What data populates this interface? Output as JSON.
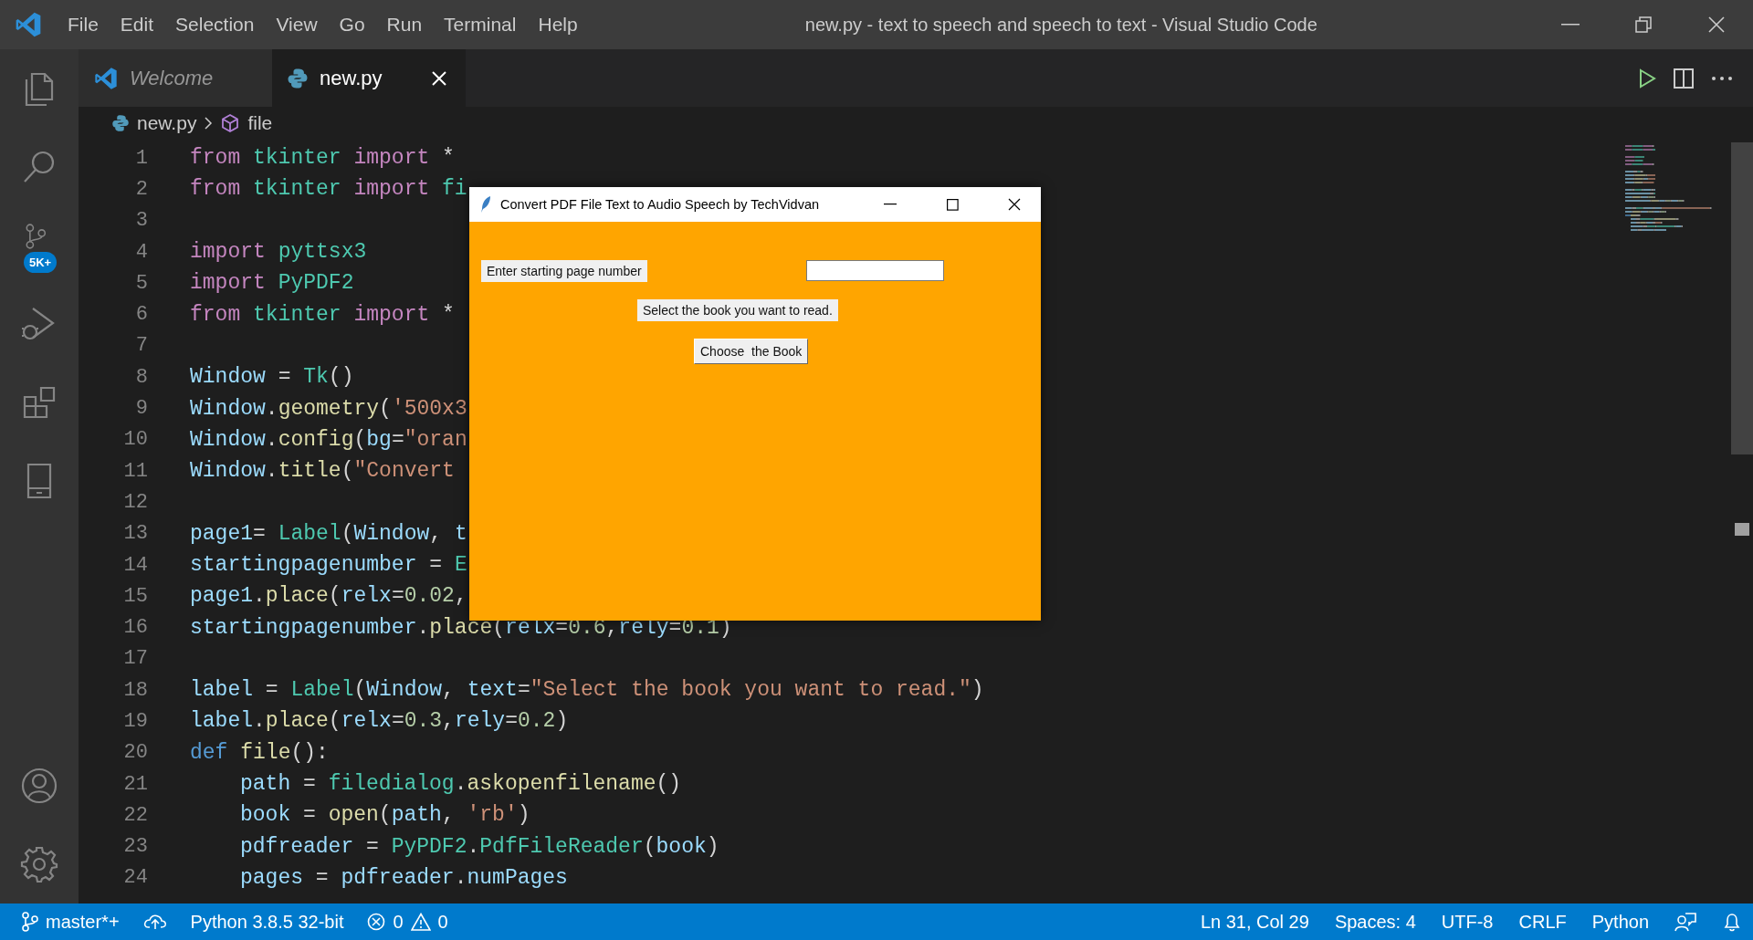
{
  "window": {
    "title": "new.py - text to speech and speech to text - Visual Studio Code"
  },
  "menu": [
    "File",
    "Edit",
    "Selection",
    "View",
    "Go",
    "Run",
    "Terminal",
    "Help"
  ],
  "activity_bar": {
    "source_control_badge": "5K+"
  },
  "tabs": [
    {
      "label": "Welcome",
      "kind": "welcome",
      "selected": false
    },
    {
      "label": "new.py",
      "kind": "python",
      "selected": true
    }
  ],
  "breadcrumb": [
    {
      "label": "new.py",
      "kind": "python"
    },
    {
      "label": "file",
      "kind": "symbol"
    }
  ],
  "code_lines": [
    {
      "number": "1",
      "tokens": [
        {
          "kind": "keyword",
          "text": "from "
        },
        {
          "kind": "module",
          "text": "tkinter "
        },
        {
          "kind": "keyword",
          "text": "import "
        },
        {
          "kind": "plain",
          "text": "*"
        }
      ]
    },
    {
      "number": "2",
      "tokens": [
        {
          "kind": "keyword",
          "text": "from "
        },
        {
          "kind": "module",
          "text": "tkinter "
        },
        {
          "kind": "keyword",
          "text": "import "
        },
        {
          "kind": "module",
          "text": "fi"
        }
      ]
    },
    {
      "number": "3"
    },
    {
      "number": "4",
      "tokens": [
        {
          "kind": "keyword",
          "text": "import "
        },
        {
          "kind": "module",
          "text": "pyttsx3"
        }
      ]
    },
    {
      "number": "5",
      "tokens": [
        {
          "kind": "keyword",
          "text": "import "
        },
        {
          "kind": "module",
          "text": "PyPDF2"
        }
      ]
    },
    {
      "number": "6",
      "tokens": [
        {
          "kind": "keyword",
          "text": "from "
        },
        {
          "kind": "module",
          "text": "tkinter "
        },
        {
          "kind": "keyword",
          "text": "import "
        },
        {
          "kind": "plain",
          "text": "*"
        }
      ]
    },
    {
      "number": "7"
    },
    {
      "number": "8",
      "tokens": [
        {
          "kind": "variable",
          "text": "Window"
        },
        {
          "kind": "plain",
          "text": " = "
        },
        {
          "kind": "module",
          "text": "Tk"
        },
        {
          "kind": "plain",
          "text": "()"
        }
      ]
    },
    {
      "number": "9",
      "tokens": [
        {
          "kind": "variable",
          "text": "Window"
        },
        {
          "kind": "plain",
          "text": "."
        },
        {
          "kind": "function",
          "text": "geometry"
        },
        {
          "kind": "plain",
          "text": "("
        },
        {
          "kind": "string",
          "text": "'500x3"
        }
      ]
    },
    {
      "number": "10",
      "tokens": [
        {
          "kind": "variable",
          "text": "Window"
        },
        {
          "kind": "plain",
          "text": "."
        },
        {
          "kind": "function",
          "text": "config"
        },
        {
          "kind": "plain",
          "text": "("
        },
        {
          "kind": "variable",
          "text": "bg"
        },
        {
          "kind": "plain",
          "text": "="
        },
        {
          "kind": "string",
          "text": "\"oran"
        }
      ]
    },
    {
      "number": "11",
      "tokens": [
        {
          "kind": "variable",
          "text": "Window"
        },
        {
          "kind": "plain",
          "text": "."
        },
        {
          "kind": "function",
          "text": "title"
        },
        {
          "kind": "plain",
          "text": "("
        },
        {
          "kind": "string",
          "text": "\"Convert"
        }
      ]
    },
    {
      "number": "12"
    },
    {
      "number": "13",
      "tokens": [
        {
          "kind": "variable",
          "text": "page1"
        },
        {
          "kind": "plain",
          "text": "= "
        },
        {
          "kind": "module",
          "text": "Label"
        },
        {
          "kind": "plain",
          "text": "("
        },
        {
          "kind": "variable",
          "text": "Window"
        },
        {
          "kind": "plain",
          "text": ", "
        },
        {
          "kind": "variable",
          "text": "t"
        }
      ]
    },
    {
      "number": "14",
      "tokens": [
        {
          "kind": "variable",
          "text": "startingpagenumber"
        },
        {
          "kind": "plain",
          "text": " = "
        },
        {
          "kind": "module",
          "text": "E"
        }
      ]
    },
    {
      "number": "15",
      "tokens": [
        {
          "kind": "variable",
          "text": "page1"
        },
        {
          "kind": "plain",
          "text": "."
        },
        {
          "kind": "function",
          "text": "place"
        },
        {
          "kind": "plain",
          "text": "("
        },
        {
          "kind": "variable",
          "text": "relx"
        },
        {
          "kind": "plain",
          "text": "="
        },
        {
          "kind": "number",
          "text": "0.02"
        },
        {
          "kind": "plain",
          "text": ","
        }
      ]
    },
    {
      "number": "16",
      "tokens": [
        {
          "kind": "variable",
          "text": "startingpagenumber"
        },
        {
          "kind": "plain",
          "text": "."
        },
        {
          "kind": "function",
          "text": "place"
        },
        {
          "kind": "plain",
          "text": "("
        },
        {
          "kind": "variable",
          "text": "relx"
        },
        {
          "kind": "plain",
          "text": "="
        },
        {
          "kind": "number",
          "text": "0.6"
        },
        {
          "kind": "plain",
          "text": ","
        },
        {
          "kind": "variable",
          "text": "rely"
        },
        {
          "kind": "plain",
          "text": "="
        },
        {
          "kind": "number",
          "text": "0.1"
        },
        {
          "kind": "plain",
          "text": ")"
        }
      ]
    },
    {
      "number": "17"
    },
    {
      "number": "18",
      "tokens": [
        {
          "kind": "variable",
          "text": "label"
        },
        {
          "kind": "plain",
          "text": " = "
        },
        {
          "kind": "module",
          "text": "Label"
        },
        {
          "kind": "plain",
          "text": "("
        },
        {
          "kind": "variable",
          "text": "Window"
        },
        {
          "kind": "plain",
          "text": ", "
        },
        {
          "kind": "variable",
          "text": "text"
        },
        {
          "kind": "plain",
          "text": "="
        },
        {
          "kind": "string",
          "text": "\"Select the book you want to read.\""
        },
        {
          "kind": "plain",
          "text": ")"
        }
      ]
    },
    {
      "number": "19",
      "tokens": [
        {
          "kind": "variable",
          "text": "label"
        },
        {
          "kind": "plain",
          "text": "."
        },
        {
          "kind": "function",
          "text": "place"
        },
        {
          "kind": "plain",
          "text": "("
        },
        {
          "kind": "variable",
          "text": "relx"
        },
        {
          "kind": "plain",
          "text": "="
        },
        {
          "kind": "number",
          "text": "0.3"
        },
        {
          "kind": "plain",
          "text": ","
        },
        {
          "kind": "variable",
          "text": "rely"
        },
        {
          "kind": "plain",
          "text": "="
        },
        {
          "kind": "number",
          "text": "0.2"
        },
        {
          "kind": "plain",
          "text": ")"
        }
      ]
    },
    {
      "number": "20",
      "tokens": [
        {
          "kind": "storage",
          "text": "def "
        },
        {
          "kind": "function",
          "text": "file"
        },
        {
          "kind": "plain",
          "text": "():"
        }
      ],
      "children": [
        {
          "number": "21",
          "tokens": [
            {
              "kind": "variable",
              "text": "path"
            },
            {
              "kind": "plain",
              "text": " = "
            },
            {
              "kind": "module",
              "text": "filedialog"
            },
            {
              "kind": "plain",
              "text": "."
            },
            {
              "kind": "function",
              "text": "askopenfilename"
            },
            {
              "kind": "plain",
              "text": "()"
            }
          ]
        },
        {
          "number": "22",
          "tokens": [
            {
              "kind": "variable",
              "text": "book"
            },
            {
              "kind": "plain",
              "text": " = "
            },
            {
              "kind": "function",
              "text": "open"
            },
            {
              "kind": "plain",
              "text": "("
            },
            {
              "kind": "variable",
              "text": "path"
            },
            {
              "kind": "plain",
              "text": ", "
            },
            {
              "kind": "string",
              "text": "'rb'"
            },
            {
              "kind": "plain",
              "text": ")"
            }
          ]
        },
        {
          "number": "23",
          "tokens": [
            {
              "kind": "variable",
              "text": "pdfreader"
            },
            {
              "kind": "plain",
              "text": " = "
            },
            {
              "kind": "module",
              "text": "PyPDF2"
            },
            {
              "kind": "plain",
              "text": "."
            },
            {
              "kind": "module",
              "text": "PdfFileReader"
            },
            {
              "kind": "plain",
              "text": "("
            },
            {
              "kind": "variable",
              "text": "book"
            },
            {
              "kind": "plain",
              "text": ")"
            }
          ]
        },
        {
          "number": "24",
          "tokens": [
            {
              "kind": "variable",
              "text": "pages"
            },
            {
              "kind": "plain",
              "text": " = "
            },
            {
              "kind": "variable",
              "text": "pdfreader"
            },
            {
              "kind": "plain",
              "text": "."
            },
            {
              "kind": "variable",
              "text": "numPages"
            }
          ]
        }
      ]
    }
  ],
  "dialog": {
    "title": "Convert PDF File Text to Audio Speech by TechVidvan",
    "prompt_label": "Enter starting page number",
    "instruction_label": "Select the book you want to read.",
    "choose_button": "Choose  the Book"
  },
  "status_bar": {
    "branch": "master*+",
    "interpreter": "Python 3.8.5 32-bit",
    "errors": "0",
    "warnings": "0",
    "cursor": "Ln 31, Col 29",
    "indentation": "Spaces: 4",
    "encoding": "UTF-8",
    "line_ending": "CRLF",
    "language": "Python"
  }
}
